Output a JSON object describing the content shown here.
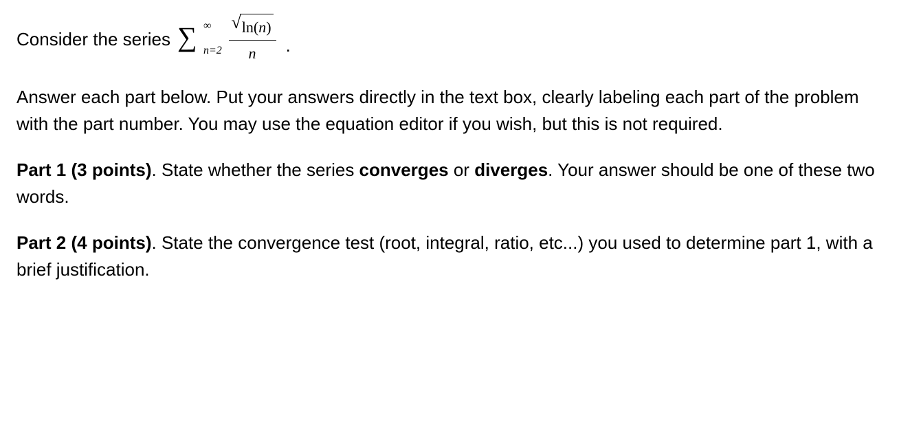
{
  "intro": {
    "prefix": "Consider the series ",
    "sigma": "∑",
    "upper": "∞",
    "lower": "n=2",
    "sqrt": "√",
    "ln": "ln",
    "open_paren": "(",
    "var_n": "n",
    "close_paren": ")",
    "denom": "n",
    "period": "."
  },
  "instructions": "Answer each part below.  Put your answers directly in the text box, clearly labeling each part of the problem with the part number.  You may use the equation editor if you wish, but this is not required.",
  "part1": {
    "label": "Part 1 (3 points)",
    "sep": ".  ",
    "text_a": "State whether the series ",
    "word_conv": "converges",
    "text_b": " or ",
    "word_div": "diverges",
    "text_c": ".  Your answer should be one of these two words."
  },
  "part2": {
    "label": "Part 2 (4 points)",
    "sep": ".  ",
    "text": "State the convergence test (root, integral, ratio, etc...) you used to determine part 1, with a brief justification."
  }
}
